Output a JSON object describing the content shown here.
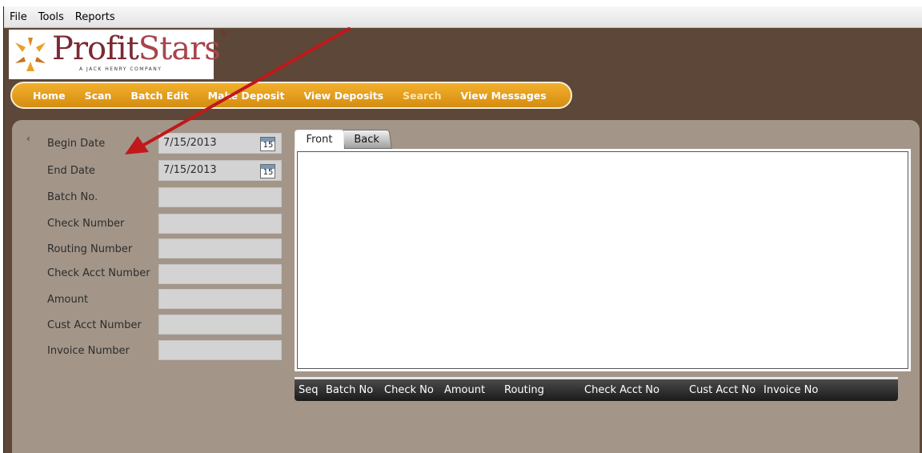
{
  "menubar": {
    "items": [
      "File",
      "Tools",
      "Reports"
    ]
  },
  "logo": {
    "name_part1": "Profit",
    "name_part2": "Stars",
    "trademark": "®",
    "tagline": "A JACK HENRY COMPANY"
  },
  "nav": {
    "items": [
      {
        "label": "Home"
      },
      {
        "label": "Scan"
      },
      {
        "label": "Batch Edit"
      },
      {
        "label": "Make Deposit"
      },
      {
        "label": "View Deposits"
      },
      {
        "label": "Search",
        "active": true
      },
      {
        "label": "View Messages"
      }
    ]
  },
  "search_form": {
    "collapse_glyph": "‹",
    "fields": [
      {
        "label": "Begin Date",
        "value": "7/15/2013",
        "type": "date"
      },
      {
        "label": "End Date",
        "value": "7/15/2013",
        "type": "date"
      },
      {
        "label": "Batch No.",
        "value": ""
      },
      {
        "label": "Check Number",
        "value": ""
      },
      {
        "label": "Routing Number",
        "value": ""
      },
      {
        "label": "Check Acct Number",
        "value": ""
      },
      {
        "label": "Amount",
        "value": ""
      },
      {
        "label": "Cust Acct Number",
        "value": ""
      },
      {
        "label": "Invoice Number",
        "value": ""
      }
    ],
    "calendar_icon": "calendar-icon",
    "calendar_day": "15"
  },
  "image_viewer": {
    "tabs": [
      "Front",
      "Back"
    ],
    "active_tab": "Front"
  },
  "results_grid": {
    "columns": [
      "Seq",
      "Batch No",
      "Check No",
      "Amount",
      "Routing",
      "Check Acct No",
      "Cust Acct No",
      "Invoice No"
    ]
  },
  "colors": {
    "window_bg": "#5c4738",
    "panel_bg": "#a39689",
    "nav_orange": "#e8a01d",
    "annotation_arrow": "#c0181b"
  }
}
